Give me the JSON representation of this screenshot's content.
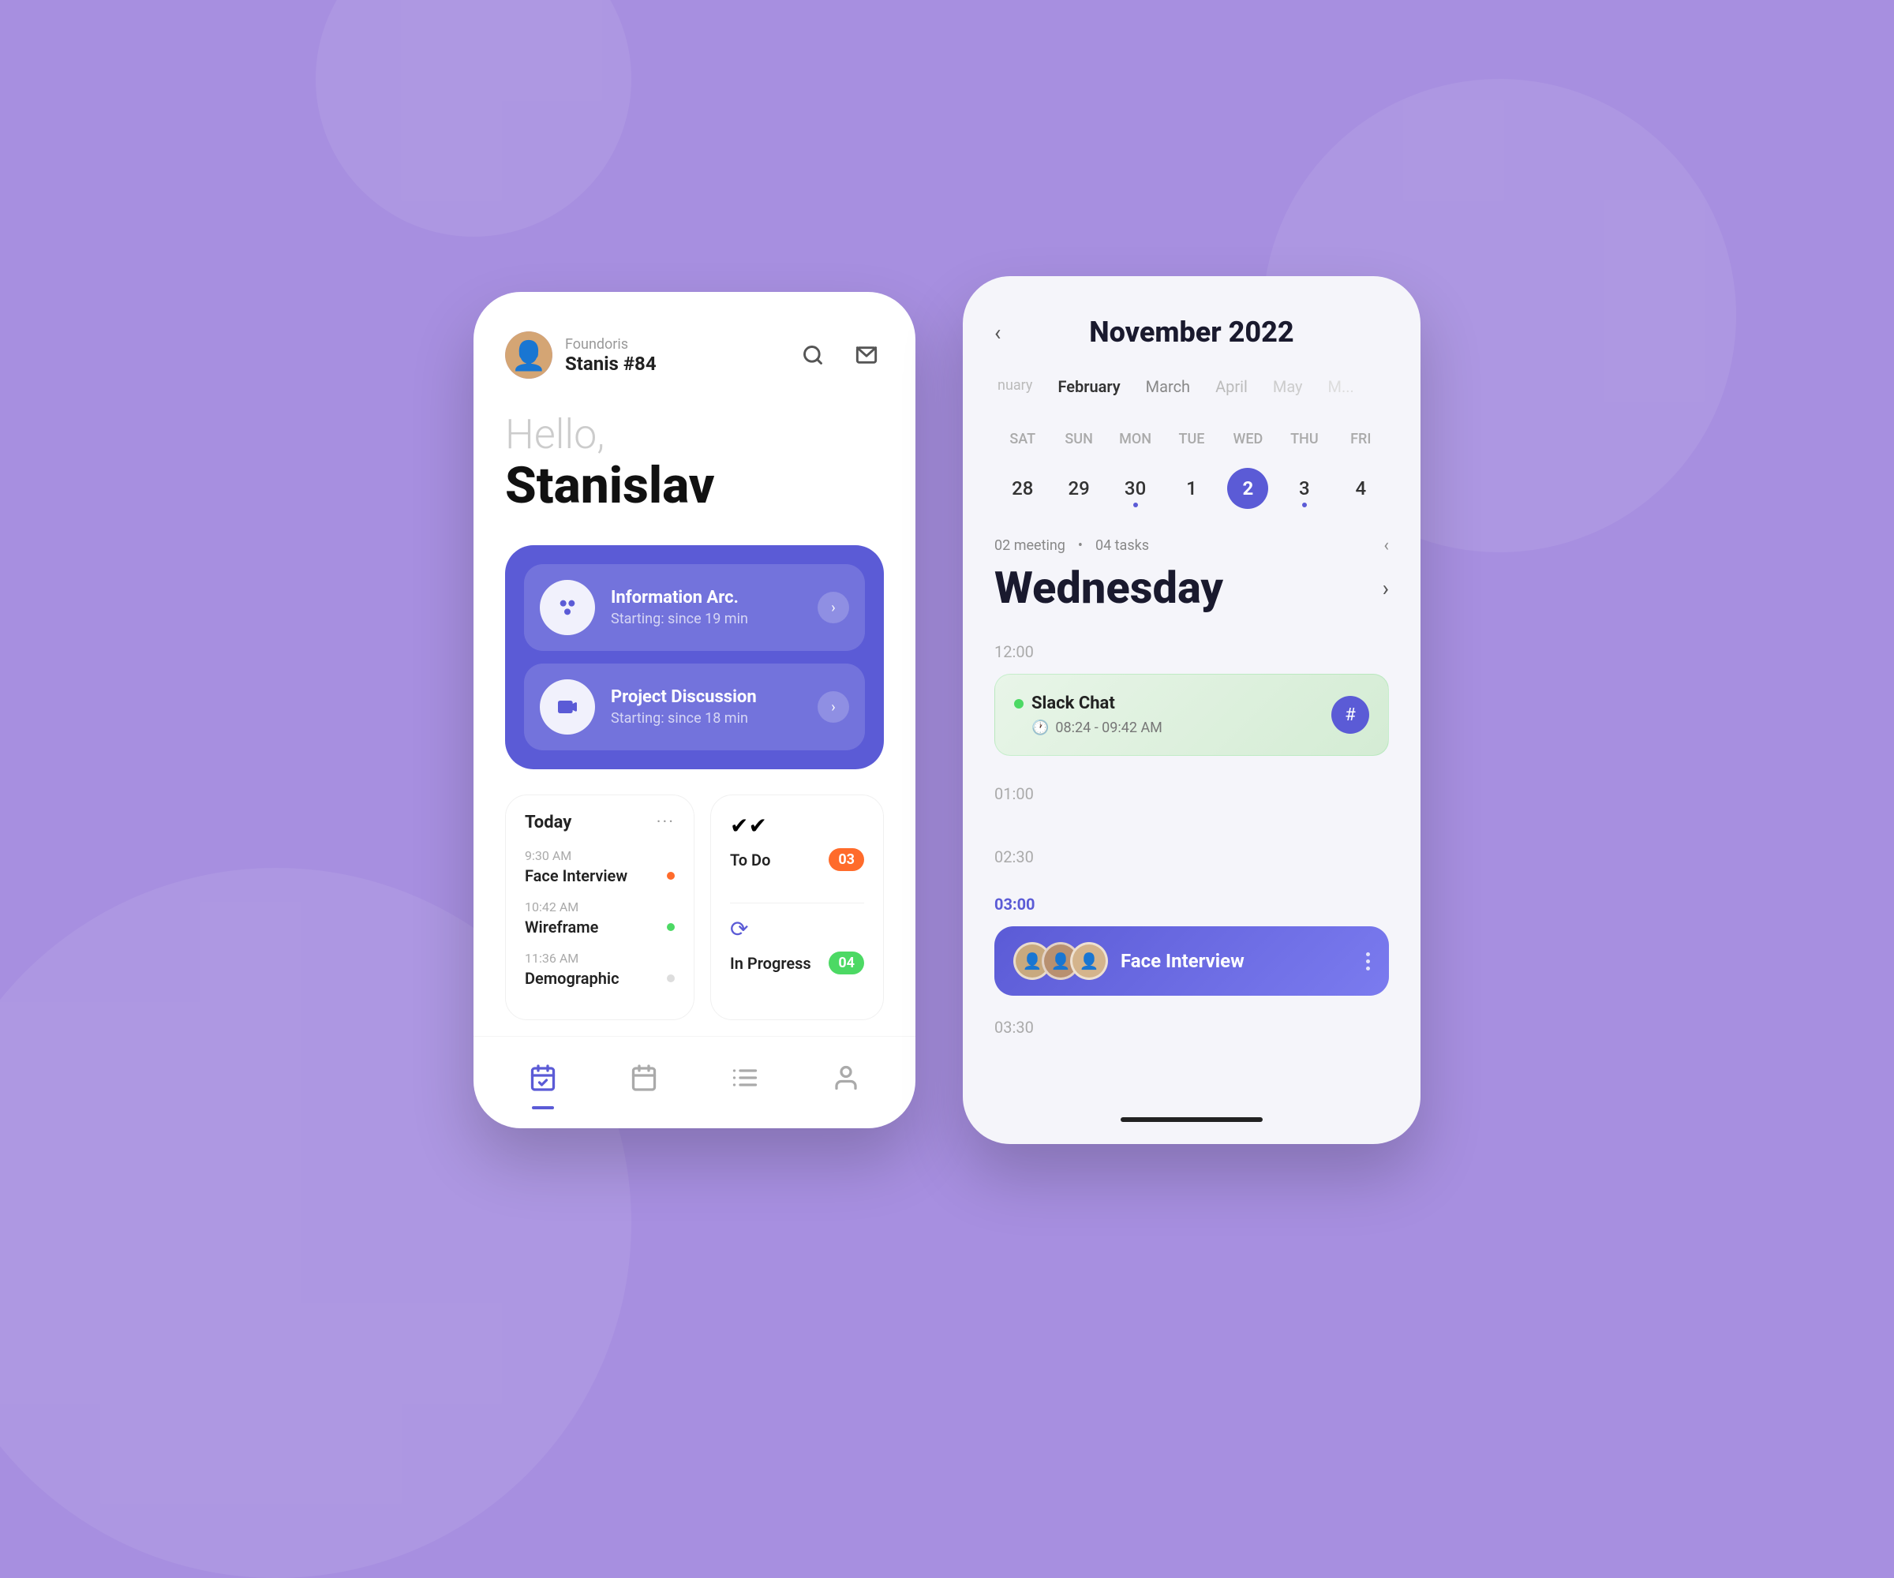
{
  "background": "#a78fe0",
  "phone1": {
    "header": {
      "company": "Foundoris",
      "username": "Stanis #84",
      "search_icon": "search",
      "mail_icon": "mail"
    },
    "greeting": {
      "hello": "Hello,",
      "name": "Stanislav"
    },
    "meetings": [
      {
        "id": "info-arc",
        "icon": "dots",
        "title": "Information Arc.",
        "subtitle": "Starting: since 19 min"
      },
      {
        "id": "project-disc",
        "icon": "video",
        "title": "Project Discussion",
        "subtitle": "Starting: since 18 min"
      }
    ],
    "today_panel": {
      "label": "Today",
      "items": [
        {
          "time": "9:30 AM",
          "task": "Face Interview",
          "dot": "orange"
        },
        {
          "time": "10:42 AM",
          "task": "Wireframe",
          "dot": "green"
        },
        {
          "time": "11:36 AM",
          "task": "Demographic",
          "dot": "gray"
        }
      ]
    },
    "tasks_panel": {
      "items": [
        {
          "icon": "checkmark",
          "label": "To Do",
          "badge": "03",
          "badge_color": "orange"
        },
        {
          "icon": "spinner",
          "label": "In Progress",
          "badge": "04",
          "badge_color": "green"
        }
      ]
    },
    "nav": [
      {
        "icon": "calendar-check",
        "active": true
      },
      {
        "icon": "calendar",
        "active": false
      },
      {
        "icon": "list",
        "active": false
      },
      {
        "icon": "person",
        "active": false
      }
    ]
  },
  "phone2": {
    "header": {
      "back_icon": "chevron-left",
      "title": "November 2022"
    },
    "months": [
      "January",
      "February",
      "March",
      "April",
      "May",
      "M..."
    ],
    "week_days": [
      "SAT",
      "SUN",
      "MON",
      "TUE",
      "WED",
      "THU",
      "FRI"
    ],
    "week_dates": [
      {
        "date": "28",
        "dot": false,
        "today": false
      },
      {
        "date": "29",
        "dot": false,
        "today": false
      },
      {
        "date": "30",
        "dot": true,
        "today": false
      },
      {
        "date": "1",
        "dot": false,
        "today": false
      },
      {
        "date": "2",
        "dot": false,
        "today": true
      },
      {
        "date": "3",
        "dot": true,
        "today": false
      },
      {
        "date": "4",
        "dot": false,
        "today": false
      }
    ],
    "day_info": {
      "meetings": "02 meeting",
      "tasks": "04 tasks",
      "back_icon": "chevron-left"
    },
    "day_title": {
      "label": "Wednesday",
      "next_icon": "chevron-right"
    },
    "timeline": {
      "time_labels": [
        "12:00",
        "01:00",
        "02:30",
        "03:00",
        "03:30"
      ],
      "slack_event": {
        "title": "Slack Chat",
        "time": "08:24 - 09:42 AM",
        "icon": "hashtag"
      },
      "interview_event": {
        "time": "03:00",
        "title": "Face Interview",
        "avatars": [
          "👤",
          "👤",
          "👤"
        ]
      }
    }
  }
}
